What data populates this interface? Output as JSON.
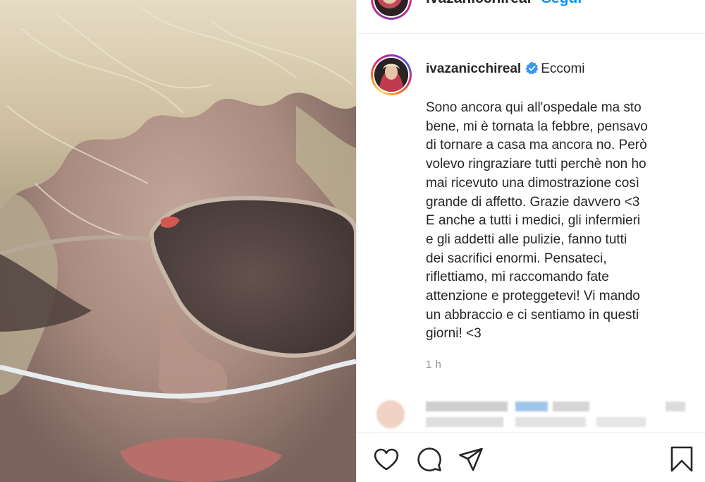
{
  "header": {
    "username": "ivazanicchireal",
    "follow_label": "Segui"
  },
  "post": {
    "username": "ivazanicchireal",
    "title": "Eccomi",
    "caption": "Sono ancora qui all'ospedale ma sto\nbene, mi è tornata la febbre, pensavo\ndi tornare a casa ma ancora no. Però\nvolevo ringraziare tutti perchè non ho\nmai ricevuto una dimostrazione così\ngrande di affetto. Grazie davvero <3\nE anche a tutti i medici, gli infermieri\ne gli addetti alle pulizie, fanno tutti\ndei sacrifici enormi. Pensateci,\nriflettiamo, mi raccomando fate\nattenzione e proteggetevi! Vi mando\nun abbraccio e ci sentiamo in questi\ngiorni! <3",
    "timestamp": "1 h"
  },
  "icons": {
    "verified": "verified-badge-icon",
    "like": "heart-icon",
    "comment": "comment-icon",
    "share": "paper-plane-icon",
    "save": "bookmark-icon"
  },
  "colors": {
    "accent": "#0095f6",
    "verified": "#3897f0",
    "text": "#262626",
    "muted": "#8e8e8e",
    "divider": "#efefef"
  }
}
